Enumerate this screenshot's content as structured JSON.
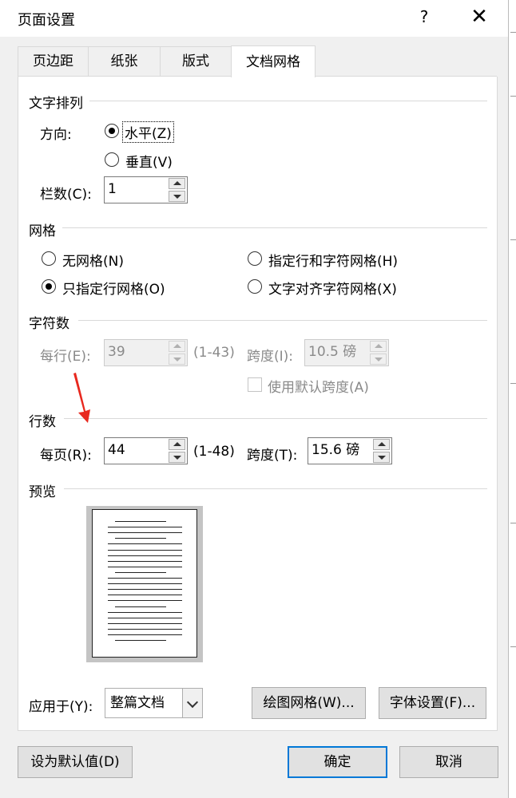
{
  "window": {
    "title": "页面设置",
    "help": "?",
    "close": "✕"
  },
  "tabs": [
    {
      "label": "页边距"
    },
    {
      "label": "纸张"
    },
    {
      "label": "版式"
    },
    {
      "label": "文档网格",
      "active": true
    }
  ],
  "text_layout": {
    "title": "文字排列",
    "direction_label": "方向:",
    "horizontal_label": "水平(Z)",
    "vertical_label": "垂直(V)",
    "selected": "水平(Z)",
    "columns_label": "栏数(C):",
    "columns_value": "1"
  },
  "grid": {
    "title": "网格",
    "options": [
      "无网格(N)",
      "指定行和字符网格(H)",
      "只指定行网格(O)",
      "文字对齐字符网格(X)"
    ],
    "selected": "只指定行网格(O)"
  },
  "characters": {
    "title": "字符数",
    "per_line_label": "每行(E):",
    "per_line_value": "39",
    "per_line_range": "(1-43)",
    "pitch_label": "跨度(I):",
    "pitch_value": "10.5 磅",
    "use_default_pitch_label": "使用默认跨度(A)",
    "use_default_pitch_checked": false,
    "disabled": true
  },
  "lines": {
    "title": "行数",
    "per_page_label": "每页(R):",
    "per_page_value": "44",
    "per_page_range": "(1-48)",
    "pitch_label": "跨度(T):",
    "pitch_value": "15.6 磅"
  },
  "preview": {
    "title": "预览"
  },
  "apply_to": {
    "label": "应用于(Y):",
    "value": "整篇文档"
  },
  "buttons": {
    "drawing_grid": "绘图网格(W)...",
    "font_settings": "字体设置(F)...",
    "set_default": "设为默认值(D)",
    "ok": "确定",
    "cancel": "取消"
  },
  "annotation": {
    "arrow_color": "#e8281e"
  },
  "colors": {
    "accent": "#0078d7",
    "disabled_text": "#8a8a8a"
  }
}
